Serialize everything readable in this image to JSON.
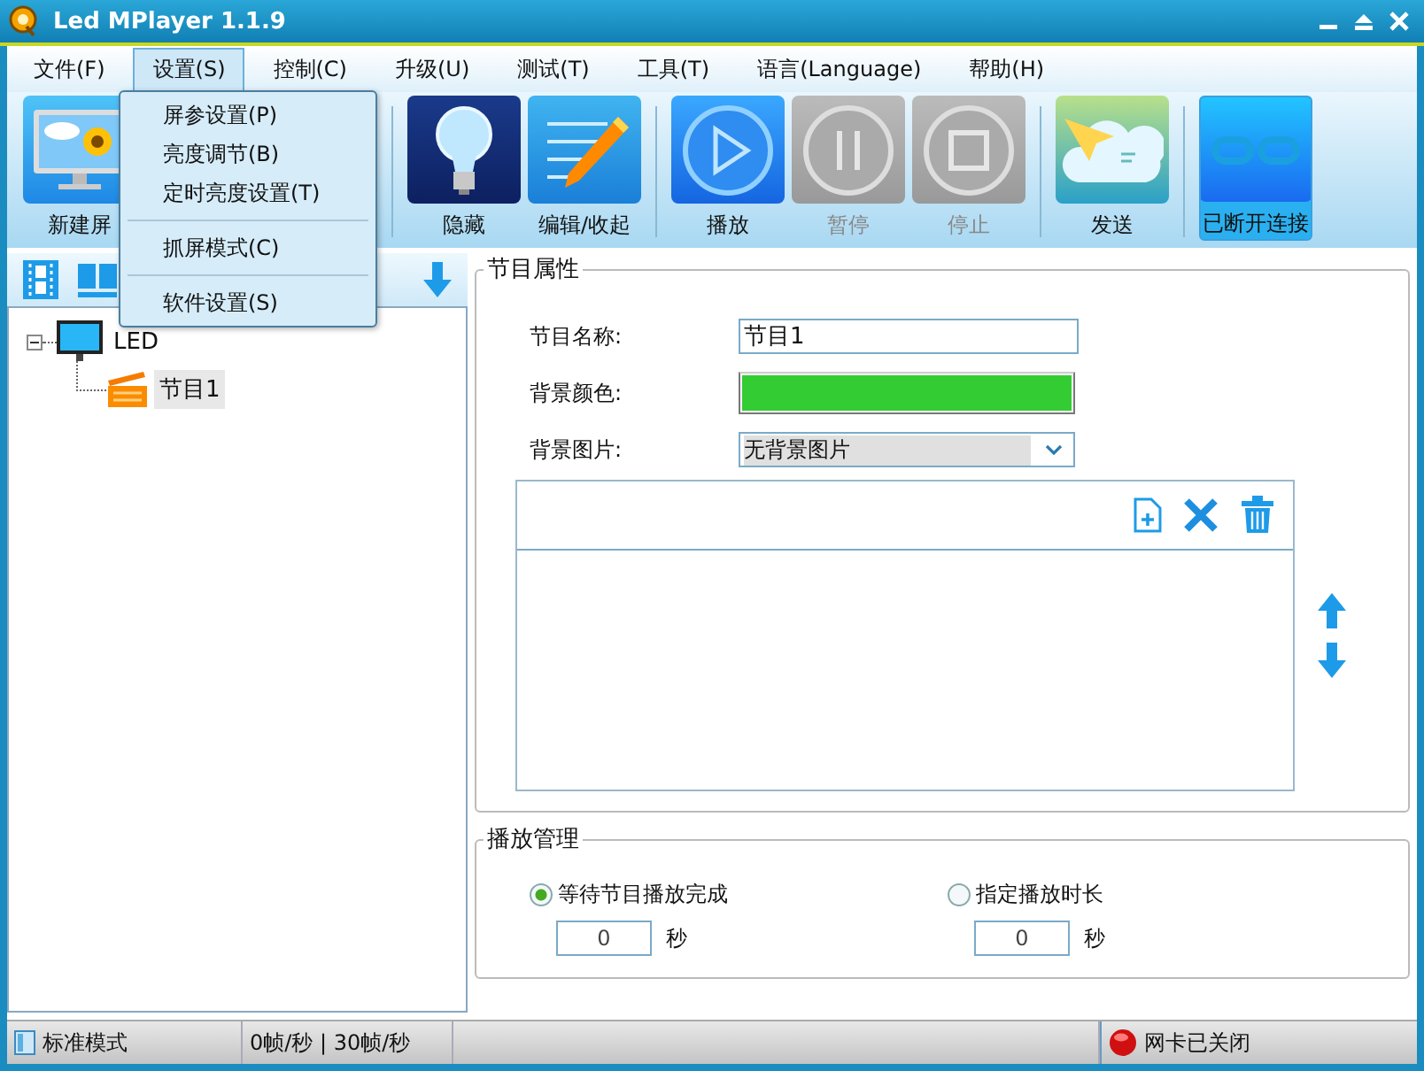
{
  "window": {
    "title": "Led MPlayer 1.1.9"
  },
  "menu": [
    {
      "label": "文件(F)",
      "selected": false
    },
    {
      "label": "设置(S)",
      "selected": true
    },
    {
      "label": "控制(C)",
      "selected": false
    },
    {
      "label": "升级(U)",
      "selected": false
    },
    {
      "label": "测试(T)",
      "selected": false
    },
    {
      "label": "工具(T)",
      "selected": false
    },
    {
      "label": "语言(Language)",
      "selected": false
    },
    {
      "label": "帮助(H)",
      "selected": false
    }
  ],
  "dropdown": [
    {
      "kind": "item",
      "label": "屏参设置(P)"
    },
    {
      "kind": "item",
      "label": "亮度调节(B)"
    },
    {
      "kind": "item",
      "label": "定时亮度设置(T)"
    },
    {
      "kind": "separator"
    },
    {
      "kind": "item",
      "label": "抓屏模式(C)"
    },
    {
      "kind": "separator"
    },
    {
      "kind": "item",
      "label": "软件设置(S)"
    }
  ],
  "toolbar": [
    {
      "kind": "monitor",
      "label": "新建屏",
      "disabled": false,
      "selected": false
    },
    {
      "kind": "covered"
    },
    {
      "kind": "covered"
    },
    {
      "kind": "separator"
    },
    {
      "kind": "bulb",
      "label": "隐藏",
      "disabled": false,
      "selected": false
    },
    {
      "kind": "pencil",
      "label": "编辑/收起",
      "disabled": false,
      "selected": false
    },
    {
      "kind": "separator"
    },
    {
      "kind": "play",
      "label": "播放",
      "disabled": false,
      "selected": false
    },
    {
      "kind": "pause",
      "label": "暂停",
      "disabled": true,
      "selected": false
    },
    {
      "kind": "stop",
      "label": "停止",
      "disabled": true,
      "selected": false
    },
    {
      "kind": "separator"
    },
    {
      "kind": "send",
      "label": "发送",
      "disabled": false,
      "selected": false
    },
    {
      "kind": "separator"
    },
    {
      "kind": "link",
      "label": "已断开连接",
      "disabled": false,
      "selected": true
    }
  ],
  "tree": [
    {
      "label": "LED",
      "expanded": true,
      "selected": false,
      "children": [
        {
          "label": "节目1",
          "selected": true
        }
      ]
    }
  ],
  "properties": {
    "title": "节目属性",
    "name_label": "节目名称:",
    "name_value": "节目1",
    "color_label": "背景颜色:",
    "color": "#33cc33",
    "image_label": "背景图片:",
    "image_value": "无背景图片"
  },
  "playback": {
    "title": "播放管理",
    "options": [
      {
        "label": "等待节目播放完成",
        "selected": true,
        "value": "0",
        "unit": "秒"
      },
      {
        "label": "指定播放时长",
        "selected": false,
        "value": "0",
        "unit": "秒"
      }
    ]
  },
  "status_bar": {
    "mode": "标准模式",
    "fps": "0帧/秒 | 30帧/秒",
    "network": "网卡已关闭"
  }
}
